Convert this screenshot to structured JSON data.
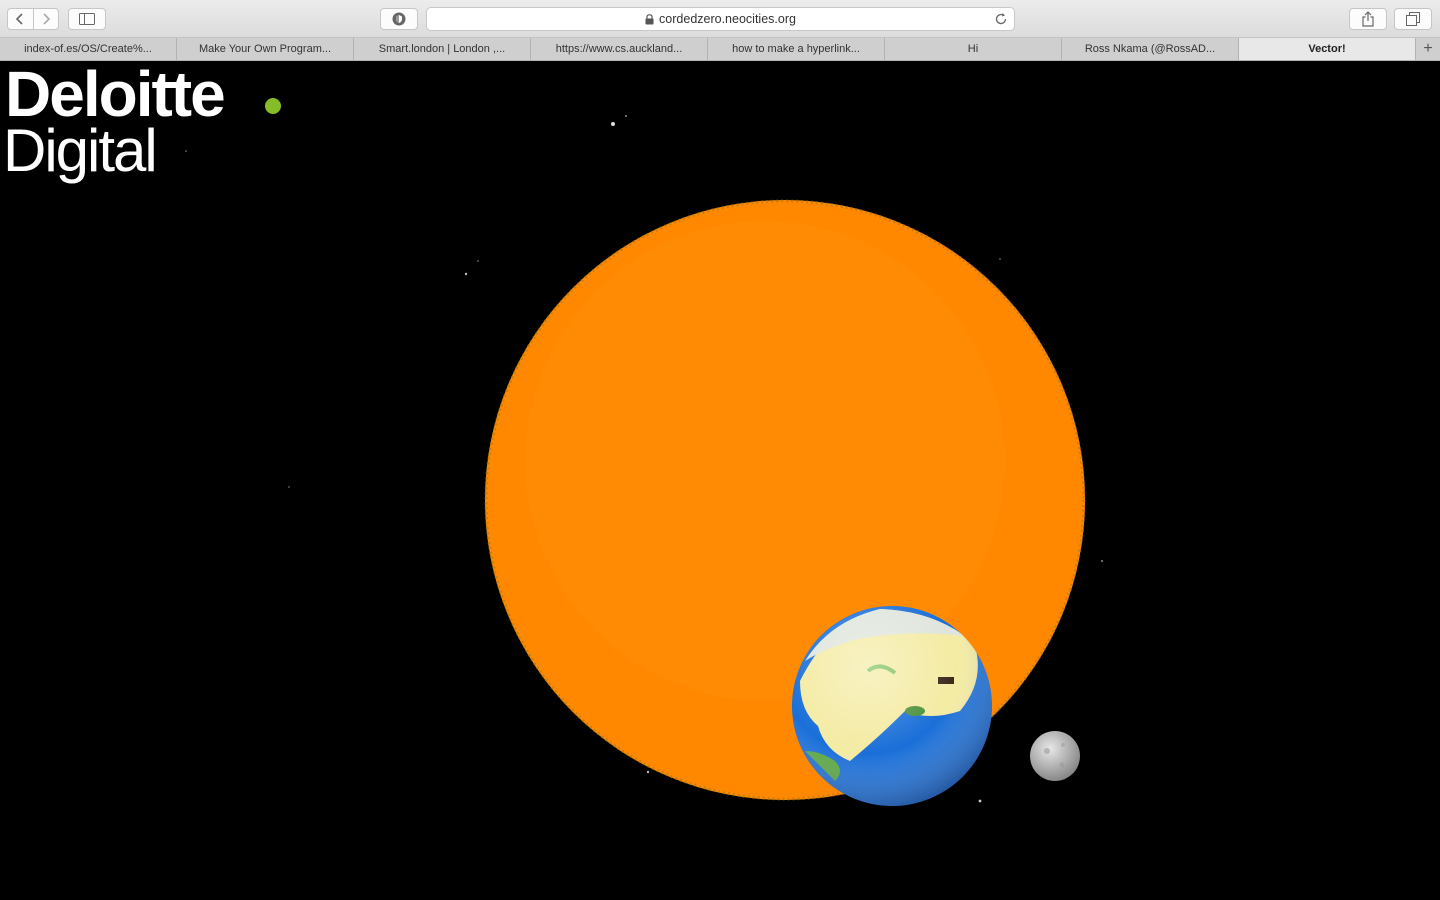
{
  "browser": {
    "url": "cordedzero.neocities.org",
    "tabs": [
      {
        "label": "index-of.es/OS/Create%...",
        "active": false
      },
      {
        "label": "Make Your Own Program...",
        "active": false
      },
      {
        "label": "Smart.london | London ,...",
        "active": false
      },
      {
        "label": "https://www.cs.auckland...",
        "active": false
      },
      {
        "label": "how to make a hyperlink...",
        "active": false
      },
      {
        "label": "Hi",
        "active": false
      },
      {
        "label": "Ross Nkama (@RossAD...",
        "active": false
      },
      {
        "label": "Vector!",
        "active": true
      }
    ],
    "new_tab_label": "+"
  },
  "page": {
    "logo": {
      "brand": "Deloitte",
      "sub": "Digital",
      "dot_color": "#86bc25"
    },
    "scene": {
      "sun_color": "#ff8800",
      "earth_ocean_color": "#1a6fd8",
      "earth_land_color": "#f4eba3",
      "moon_color": "#bfbfbf"
    }
  }
}
